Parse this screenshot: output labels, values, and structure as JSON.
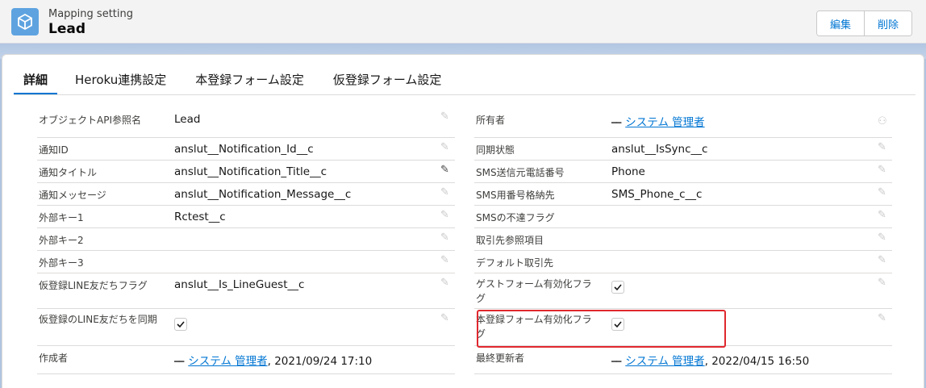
{
  "header": {
    "object_type": "Mapping setting",
    "title": "Lead",
    "edit_label": "編集",
    "delete_label": "削除",
    "icon": "cube-icon"
  },
  "tabs": [
    "詳細",
    "Heroku連携設定",
    "本登録フォーム設定",
    "仮登録フォーム設定"
  ],
  "left_fields": [
    {
      "label": "オブジェクトAPI参照名",
      "value": "Lead"
    },
    {
      "label": "通知ID",
      "value": "anslut__Notification_Id__c"
    },
    {
      "label": "通知タイトル",
      "value": "anslut__Notification_Title__c"
    },
    {
      "label": "通知メッセージ",
      "value": "anslut__Notification_Message__c"
    },
    {
      "label": "外部キー1",
      "value": "Rctest__c"
    },
    {
      "label": "外部キー2",
      "value": ""
    },
    {
      "label": "外部キー3",
      "value": ""
    },
    {
      "label": "仮登録LINE友だちフラグ",
      "value": "anslut__Is_LineGuest__c"
    },
    {
      "label": "仮登録のLINE友だちを同期",
      "checked": true
    },
    {
      "label": "作成者",
      "user": "システム 管理者",
      "date": ", 2021/09/24 17:10"
    }
  ],
  "right_fields": [
    {
      "label": "所有者",
      "user": "システム 管理者"
    },
    {
      "label": "同期状態",
      "value": "anslut__IsSync__c"
    },
    {
      "label": "SMS送信元電話番号",
      "value": "Phone"
    },
    {
      "label": "SMS用番号格納先",
      "value": "SMS_Phone_c__c"
    },
    {
      "label": "SMSの不達フラグ",
      "value": ""
    },
    {
      "label": "取引先参照項目",
      "value": ""
    },
    {
      "label": "デフォルト取引先",
      "value": ""
    },
    {
      "label": "ゲストフォーム有効化フラグ",
      "checked": true
    },
    {
      "label": "本登録フォーム有効化フラグ",
      "checked": true
    },
    {
      "label": "最終更新者",
      "user": "システム 管理者",
      "date": ", 2022/04/15 16:50"
    }
  ],
  "colors": {
    "accent": "#0176d3",
    "highlight": "#e0282e",
    "icon_bg": "#5ea3e0"
  }
}
